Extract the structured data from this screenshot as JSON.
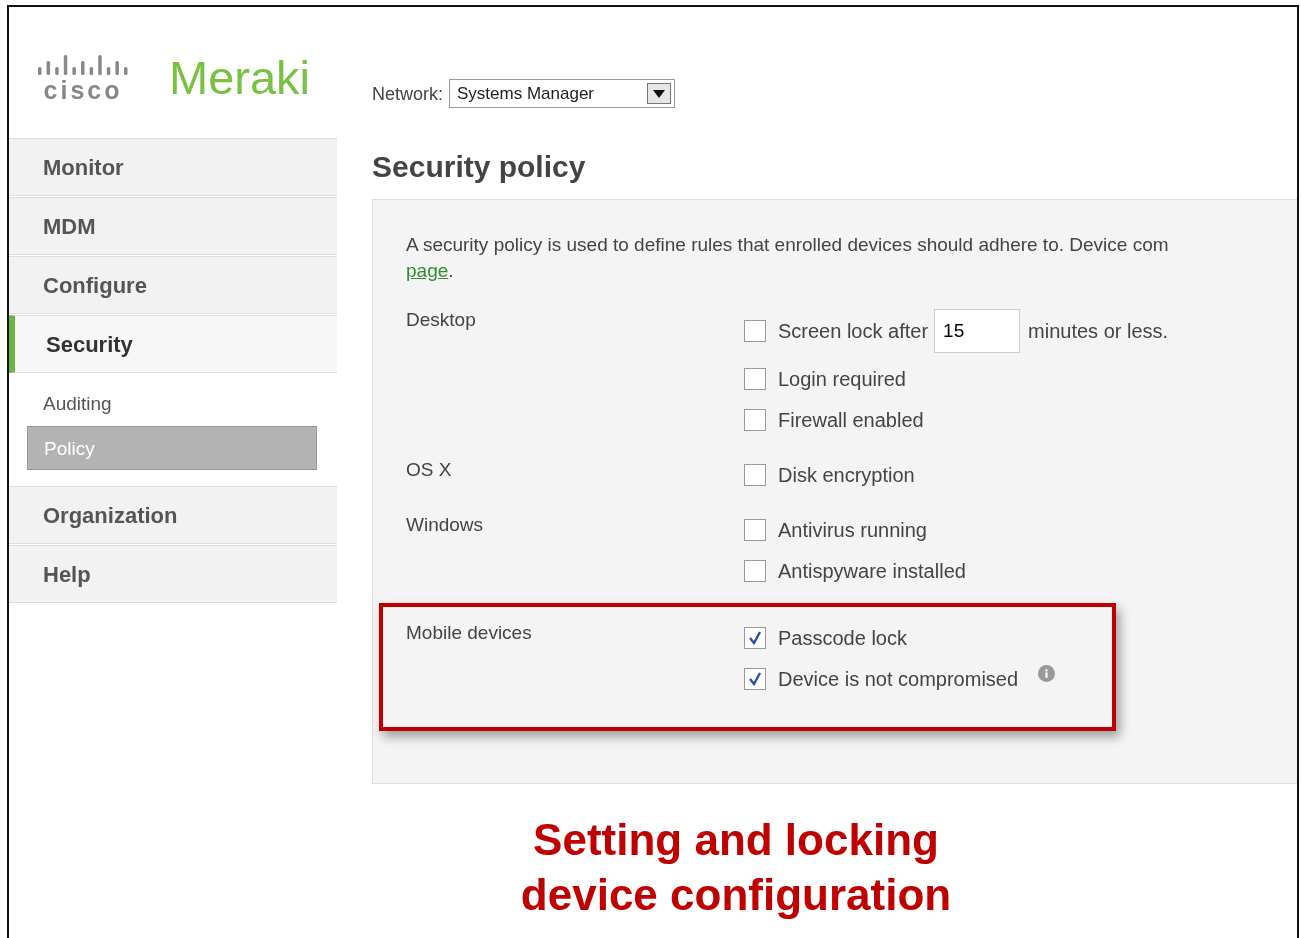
{
  "logo": {
    "brand": "cisco",
    "product": "Meraki"
  },
  "network": {
    "label": "Network:",
    "value": "Systems Manager"
  },
  "sidebar": {
    "items": [
      {
        "label": "Monitor",
        "selected": false
      },
      {
        "label": "MDM",
        "selected": false
      },
      {
        "label": "Configure",
        "selected": false
      },
      {
        "label": "Security",
        "selected": true,
        "children": [
          {
            "label": "Auditing",
            "selected": false
          },
          {
            "label": "Policy",
            "selected": true
          }
        ]
      },
      {
        "label": "Organization",
        "selected": false
      },
      {
        "label": "Help",
        "selected": false
      }
    ]
  },
  "page": {
    "title": "Security policy",
    "intro": {
      "text": "A security policy is used to define rules that enrolled devices should adhere to. Device com",
      "link": "page",
      "after": "."
    },
    "groups": [
      {
        "label": "Desktop",
        "highlighted": false,
        "options": [
          {
            "kind": "minutes",
            "label": "Screen lock after",
            "value": "15",
            "suffix": "minutes or less.",
            "checked": false,
            "info": false
          },
          {
            "kind": "checkbox",
            "label": "Login required",
            "checked": false,
            "info": false
          },
          {
            "kind": "checkbox",
            "label": "Firewall enabled",
            "checked": false,
            "info": false
          }
        ]
      },
      {
        "label": "OS X",
        "highlighted": false,
        "options": [
          {
            "kind": "checkbox",
            "label": "Disk encryption",
            "checked": false,
            "info": false
          }
        ]
      },
      {
        "label": "Windows",
        "highlighted": false,
        "options": [
          {
            "kind": "checkbox",
            "label": "Antivirus running",
            "checked": false,
            "info": false
          },
          {
            "kind": "checkbox",
            "label": "Antispyware installed",
            "checked": false,
            "info": false
          }
        ]
      },
      {
        "label": "Mobile devices",
        "highlighted": true,
        "options": [
          {
            "kind": "checkbox",
            "label": "Passcode lock",
            "checked": true,
            "info": false
          },
          {
            "kind": "checkbox",
            "label": "Device is not compromised",
            "checked": true,
            "info": true
          }
        ]
      }
    ]
  },
  "caption": [
    "Setting and locking",
    "device configuration"
  ]
}
